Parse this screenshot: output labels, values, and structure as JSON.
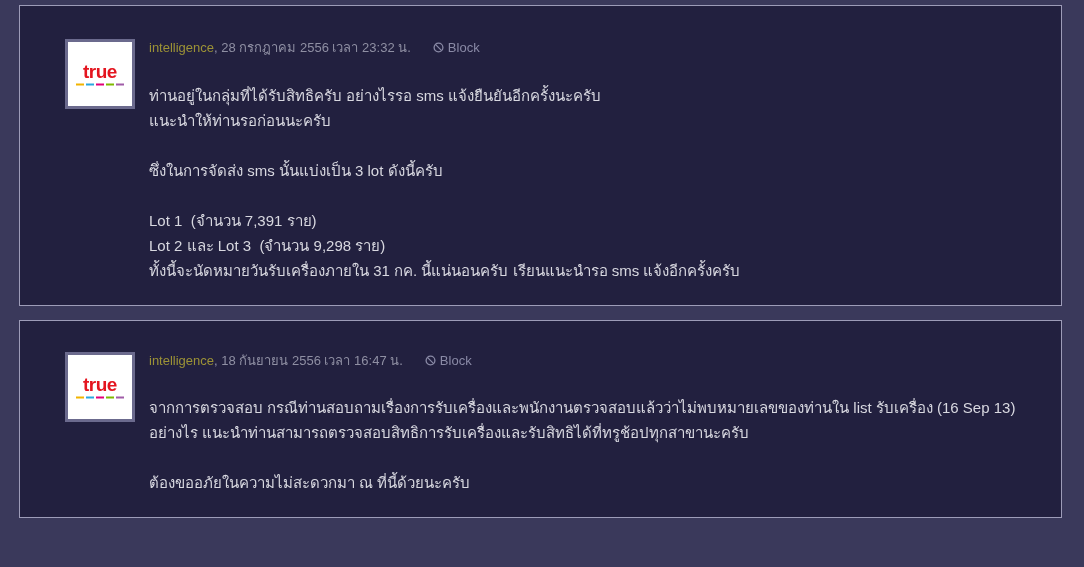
{
  "posts": [
    {
      "author": "intelligence",
      "date": ", 28 กรกฎาคม 2556 เวลา 23:32 น.",
      "block_label": "Block",
      "logo_text": "true",
      "paragraphs": [
        [
          "ท่านอยู่ในกลุ่มที่ได้รับสิทธิครับ อย่างไรรอ sms แจ้งยืนยันอีกครั้งนะครับ",
          "แนะนำให้ท่านรอก่อนนะครับ"
        ],
        [
          "ซึ่งในการจัดส่ง sms นั้นแบ่งเป็น 3 lot ดังนี้ครับ"
        ],
        [
          "Lot 1  (จำนวน 7,391 ราย)",
          "Lot 2 และ Lot 3  (จำนวน 9,298 ราย)",
          "ทั้งนี้จะนัดหมายวันรับเครื่องภายใน 31 กค. นี้แน่นอนครับ เรียนแนะนำรอ sms แจ้งอีกครั้งครับ"
        ]
      ]
    },
    {
      "author": "intelligence",
      "date": ", 18 กันยายน 2556 เวลา 16:47 น.",
      "block_label": "Block",
      "logo_text": "true",
      "paragraphs": [
        [
          "จากการตรวจสอบ กรณีท่านสอบถามเรื่องการรับเครื่องและพนักงานตรวจสอบแล้วว่าไม่พบหมายเลขของท่านใน list รับเครื่อง (16 Sep 13)",
          "อย่างไร แนะนำท่านสามารถตรวจสอบสิทธิการรับเครื่องและรับสิทธิได้ที่ทรูช้อปทุกสาขานะครับ"
        ],
        [
          "ต้องขออภัยในความไม่สะดวกมา ณ ที่นี้ด้วยนะครับ"
        ]
      ]
    }
  ]
}
